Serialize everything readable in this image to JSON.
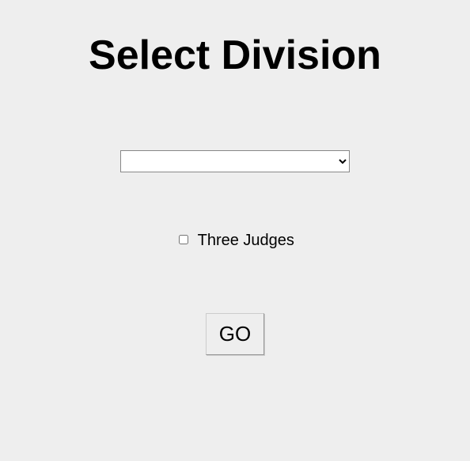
{
  "heading": "Select Division",
  "division_select": {
    "selected": "",
    "options": []
  },
  "checkbox": {
    "label": "Three Judges",
    "checked": false
  },
  "go_label": "GO"
}
